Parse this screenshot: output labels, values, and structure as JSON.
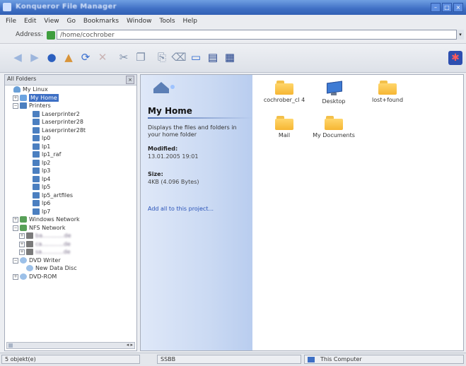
{
  "window": {
    "title": "Konqueror File Manager"
  },
  "menu": [
    "File",
    "Edit",
    "View",
    "Go",
    "Bookmarks",
    "Window",
    "Tools",
    "Help"
  ],
  "address": {
    "label": "Address:",
    "value": "/home/cochrober"
  },
  "sidebar": {
    "header": "All Folders",
    "close": "×",
    "scroll_arrows": "◂ ▸",
    "tree": [
      {
        "label": "My Linux",
        "indent": 0,
        "icon": "user",
        "exp": ""
      },
      {
        "label": "My Home",
        "indent": 1,
        "icon": "home",
        "exp": "+",
        "selected": true
      },
      {
        "label": "Printers",
        "indent": 1,
        "icon": "printer",
        "exp": "−"
      },
      {
        "label": "Laserprinter2",
        "indent": 3,
        "icon": "printer",
        "exp": ""
      },
      {
        "label": "Laserprinter28",
        "indent": 3,
        "icon": "printer",
        "exp": ""
      },
      {
        "label": "Laserprinter28t",
        "indent": 3,
        "icon": "printer",
        "exp": ""
      },
      {
        "label": "lp0",
        "indent": 3,
        "icon": "printer",
        "exp": ""
      },
      {
        "label": "lp1",
        "indent": 3,
        "icon": "printer",
        "exp": ""
      },
      {
        "label": "lp1_raf",
        "indent": 3,
        "icon": "printer",
        "exp": ""
      },
      {
        "label": "lp2",
        "indent": 3,
        "icon": "printer",
        "exp": ""
      },
      {
        "label": "lp3",
        "indent": 3,
        "icon": "printer",
        "exp": ""
      },
      {
        "label": "lp4",
        "indent": 3,
        "icon": "printer",
        "exp": ""
      },
      {
        "label": "lp5",
        "indent": 3,
        "icon": "printer",
        "exp": ""
      },
      {
        "label": "lp5_artfiles",
        "indent": 3,
        "icon": "printer",
        "exp": ""
      },
      {
        "label": "lp6",
        "indent": 3,
        "icon": "printer",
        "exp": ""
      },
      {
        "label": "lp7",
        "indent": 3,
        "icon": "printer",
        "exp": ""
      },
      {
        "label": "Windows Network",
        "indent": 1,
        "icon": "net",
        "exp": "+"
      },
      {
        "label": "NFS Network",
        "indent": 1,
        "icon": "net",
        "exp": "−"
      },
      {
        "label": "ba............de",
        "indent": 2,
        "icon": "host",
        "exp": "+",
        "blurred": true
      },
      {
        "label": "ca............de",
        "indent": 2,
        "icon": "host",
        "exp": "+",
        "blurred": true
      },
      {
        "label": "sa............de",
        "indent": 2,
        "icon": "host",
        "exp": "+",
        "blurred": true
      },
      {
        "label": "DVD Writer",
        "indent": 1,
        "icon": "disc",
        "exp": "−"
      },
      {
        "label": "New Data Disc",
        "indent": 2,
        "icon": "disc",
        "exp": ""
      },
      {
        "label": "DVD-ROM",
        "indent": 1,
        "icon": "disc",
        "exp": "+"
      }
    ]
  },
  "info": {
    "title": "My Home",
    "description": "Displays the files and folders in your home folder",
    "modified_label": "Modified:",
    "modified_value": "13.01.2005 19:01",
    "size_label": "Size:",
    "size_value": "4KB (4.096 Bytes)",
    "link": "Add all to this project..."
  },
  "files": [
    {
      "name": "cochrober_cl 4",
      "icon": "folder"
    },
    {
      "name": "Desktop",
      "icon": "desktop"
    },
    {
      "name": "lost+found",
      "icon": "folder"
    },
    {
      "name": "Mail",
      "icon": "folder"
    },
    {
      "name": "My Documents",
      "icon": "folder"
    }
  ],
  "status": {
    "left": "5 objekt(e)",
    "middle": "SSBB",
    "right": "This Computer"
  },
  "colors": {
    "title_bar": "#3f6fc4",
    "selection": "#3d6fc4",
    "folder": "#f6b633"
  }
}
